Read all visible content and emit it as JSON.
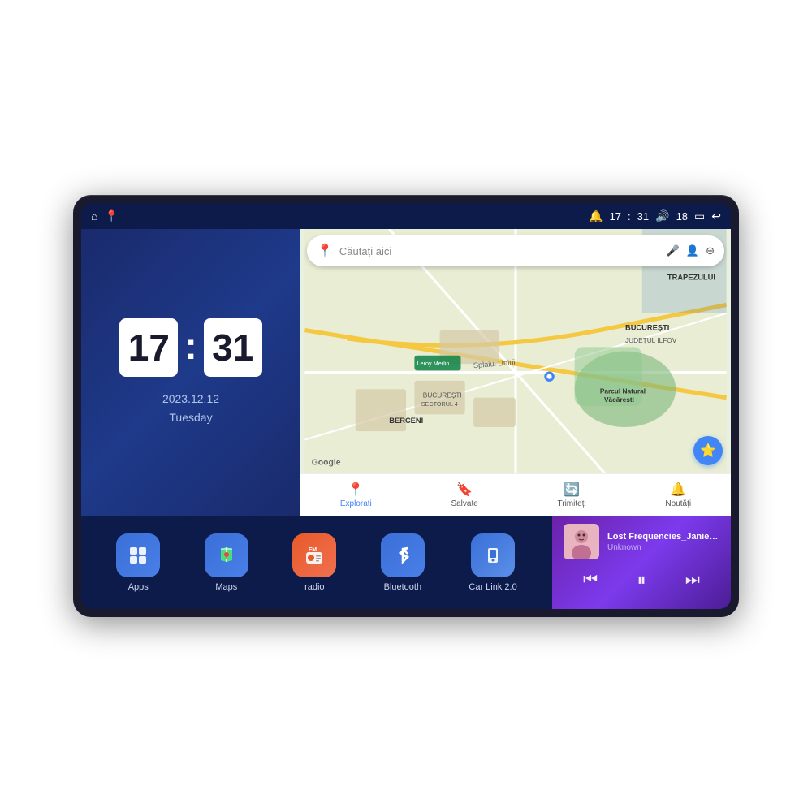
{
  "device": {
    "screen": {
      "statusBar": {
        "leftIcons": [
          "⌂",
          "📍"
        ],
        "time": "17:31",
        "rightIcons": [
          "🔔",
          "18",
          "▭",
          "↩"
        ]
      }
    },
    "clock": {
      "hours": "17",
      "minutes": "31",
      "date": "2023.12.12",
      "day": "Tuesday"
    },
    "map": {
      "searchPlaceholder": "Căutați aici",
      "micLabel": "🎤",
      "accountLabel": "👤",
      "layersLabel": "⊕",
      "locations": {
        "trapezului": "TRAPEZULUI",
        "bucuresti": "BUCUREȘTI",
        "judetulIlfov": "JUDEȚUL ILFOV",
        "berceni": "BERCENI",
        "sectorulBucuresti": "BUCUREȘTI SECTORUL 4",
        "leroy": "Leroy Merlin",
        "parcul": "Parcul Natural Văcărești"
      },
      "navItems": [
        {
          "label": "Explorați",
          "icon": "📍",
          "active": true
        },
        {
          "label": "Salvate",
          "icon": "🔖",
          "active": false
        },
        {
          "label": "Trimiteți",
          "icon": "🔄",
          "active": false
        },
        {
          "label": "Noutăți",
          "icon": "🔔",
          "active": false
        }
      ]
    },
    "apps": [
      {
        "id": "apps",
        "label": "Apps",
        "icon": "⊞",
        "colorClass": "app-apps"
      },
      {
        "id": "maps",
        "label": "Maps",
        "icon": "📍",
        "colorClass": "app-maps"
      },
      {
        "id": "radio",
        "label": "radio",
        "icon": "📻",
        "colorClass": "app-radio"
      },
      {
        "id": "bluetooth",
        "label": "Bluetooth",
        "icon": "🔵",
        "colorClass": "app-bt"
      },
      {
        "id": "carlink",
        "label": "Car Link 2.0",
        "icon": "📱",
        "colorClass": "app-carlink"
      }
    ],
    "musicPlayer": {
      "title": "Lost Frequencies_Janieck Devy-...",
      "artist": "Unknown",
      "controls": {
        "prev": "⏮",
        "play": "⏸",
        "next": "⏭"
      }
    }
  }
}
